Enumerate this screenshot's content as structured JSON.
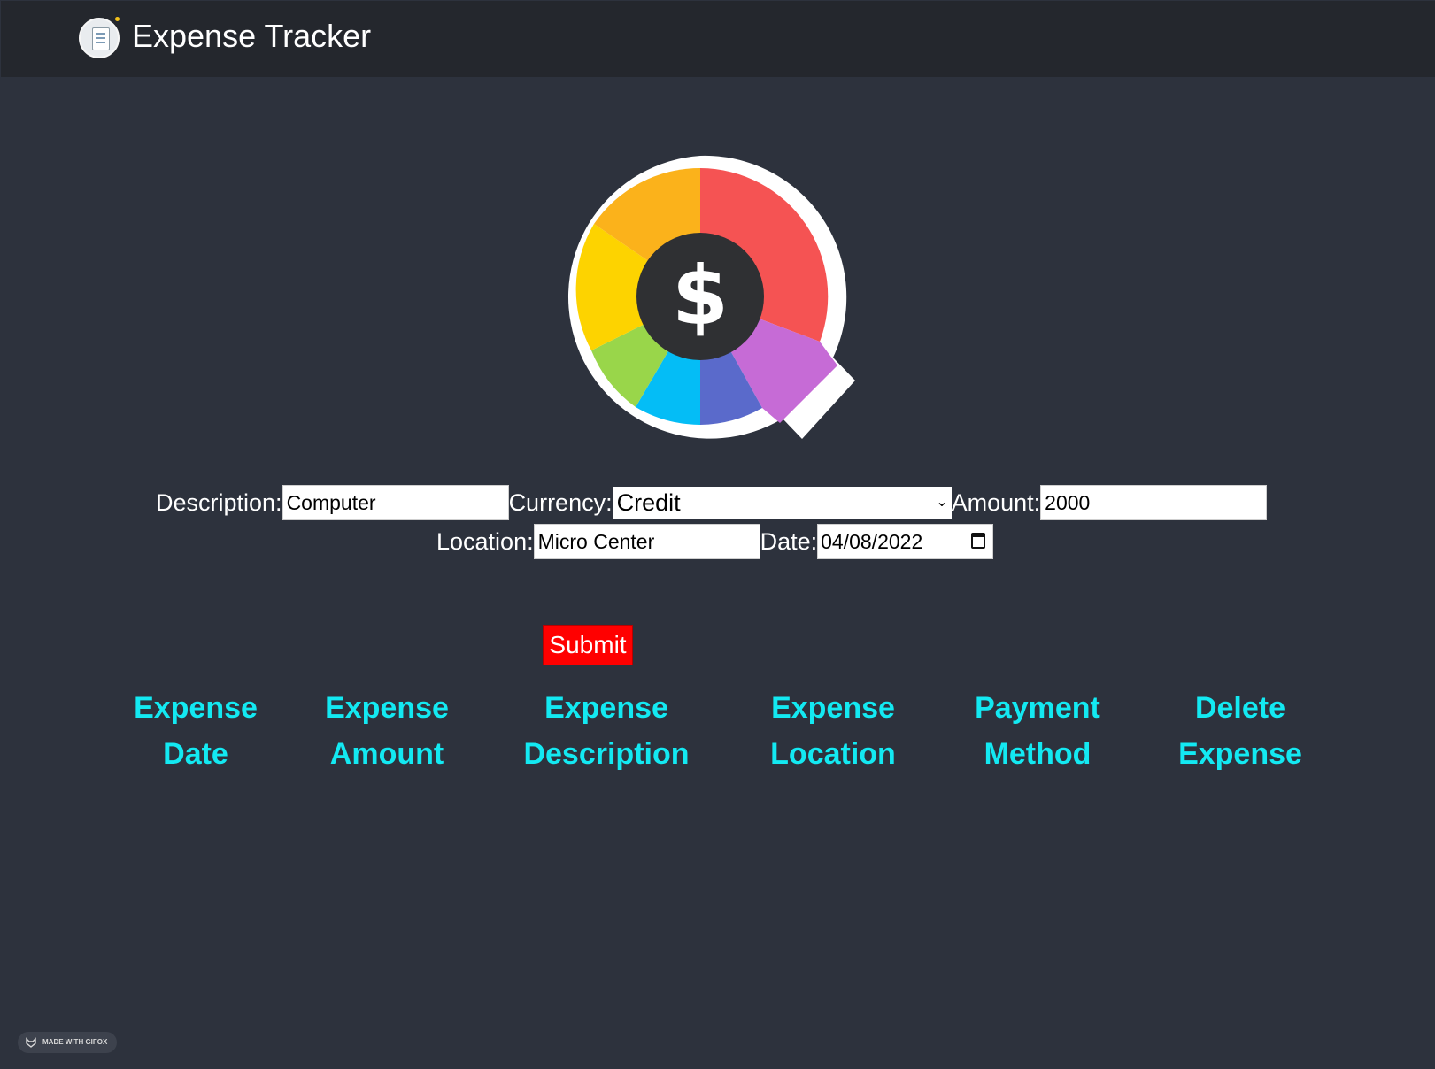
{
  "app": {
    "title": "Expense Tracker",
    "logo_icon": "ledger-icon",
    "hero_icon": "dollar-pie-chart-icon"
  },
  "form": {
    "description": {
      "label": "Description:",
      "value": "Computer"
    },
    "currency": {
      "label": "Currency:",
      "selected": "Credit"
    },
    "amount": {
      "label": "Amount:",
      "value": "2000"
    },
    "location": {
      "label": "Location:",
      "value": "Micro Center"
    },
    "date": {
      "label": "Date:",
      "value": "04/08/2022"
    },
    "submit_label": "Submit"
  },
  "table": {
    "headers": [
      {
        "line1": "Expense",
        "line2": "Date"
      },
      {
        "line1": "Expense",
        "line2": "Amount"
      },
      {
        "line1": "Expense",
        "line2": "Description"
      },
      {
        "line1": "Expense",
        "line2": "Location"
      },
      {
        "line1": "Payment",
        "line2": "Method"
      },
      {
        "line1": "Delete",
        "line2": "Expense"
      }
    ],
    "rows": []
  },
  "watermark": {
    "text": "MADE WITH GIFOX"
  },
  "colors": {
    "background": "#2d323d",
    "navbar": "#24272d",
    "header_text": "#13e9f2",
    "submit": "#ff0000"
  }
}
